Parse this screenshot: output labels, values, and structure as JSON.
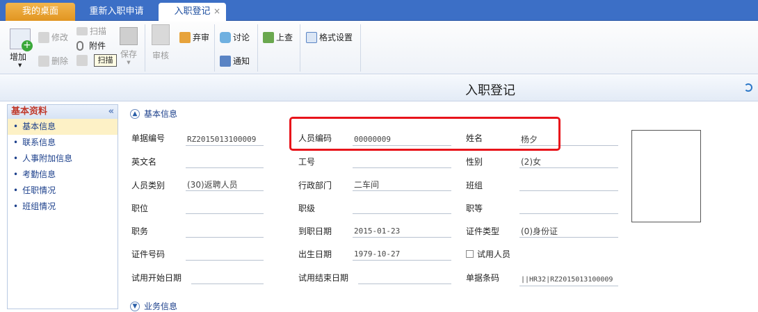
{
  "tabs": [
    {
      "label": "我的桌面"
    },
    {
      "label": "重新入职申请"
    },
    {
      "label": "入职登记",
      "close": "×"
    }
  ],
  "toolbar": {
    "add": "增加",
    "edit": "修改",
    "delete": "删除",
    "scan": "扫描",
    "attach": "附件",
    "save": "保存",
    "review": "审核",
    "abandon": "弃审",
    "discuss": "讨论",
    "notify": "通知",
    "lookup": "上查",
    "format": "格式设置",
    "tooltip": "扫描"
  },
  "page": {
    "title": "入职登记"
  },
  "sidebar": {
    "header": "基本资料",
    "collapse": "«",
    "items": [
      {
        "label": "基本信息"
      },
      {
        "label": "联系信息"
      },
      {
        "label": "人事附加信息"
      },
      {
        "label": "考勤信息"
      },
      {
        "label": "任职情况"
      },
      {
        "label": "班组情况"
      }
    ]
  },
  "sections": {
    "basic": "基本信息",
    "business": "业务信息"
  },
  "fields": {
    "doc_no": {
      "label": "单据编号",
      "value": "RZ2015013100009"
    },
    "emp_code": {
      "label": "人员编码",
      "value": "00000009"
    },
    "name": {
      "label": "姓名",
      "value": "杨夕"
    },
    "en_name": {
      "label": "英文名",
      "value": ""
    },
    "job_no": {
      "label": "工号",
      "value": ""
    },
    "gender": {
      "label": "性别",
      "value": "(2)女"
    },
    "category": {
      "label": "人员类别",
      "value": "(30)返聘人员"
    },
    "dept": {
      "label": "行政部门",
      "value": "二车间"
    },
    "team": {
      "label": "班组",
      "value": ""
    },
    "position": {
      "label": "职位",
      "value": ""
    },
    "rank": {
      "label": "职级",
      "value": ""
    },
    "grade": {
      "label": "职等",
      "value": ""
    },
    "duty": {
      "label": "职务",
      "value": ""
    },
    "join_date": {
      "label": "到职日期",
      "value": "2015-01-23"
    },
    "id_type": {
      "label": "证件类型",
      "value": "(0)身份证"
    },
    "id_no": {
      "label": "证件号码",
      "value": ""
    },
    "birth": {
      "label": "出生日期",
      "value": "1979-10-27"
    },
    "probation": {
      "label": "试用人员"
    },
    "prob_start": {
      "label": "试用开始日期",
      "value": ""
    },
    "prob_end": {
      "label": "试用结束日期",
      "value": ""
    },
    "barcode": {
      "label": "单据条码",
      "value": "||HR32|RZ2015013100009"
    }
  },
  "colors": {
    "tabbar": "#3c6fc6",
    "home_tab": "#e19521",
    "highlight": "#e8141b",
    "link": "#1b3f8b"
  }
}
